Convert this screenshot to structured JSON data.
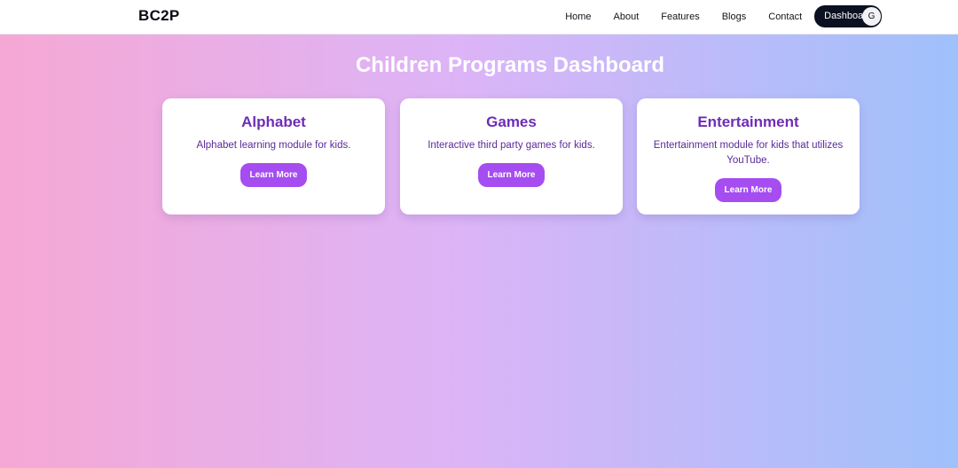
{
  "navbar": {
    "brand": "BC2P",
    "links": [
      "Home",
      "About",
      "Features",
      "Blogs",
      "Contact"
    ],
    "active_link": "Dashboard",
    "avatar_initial": "G"
  },
  "page": {
    "title": "Children Programs Dashboard"
  },
  "cards": [
    {
      "title": "Alphabet",
      "description": "Alphabet learning module for kids.",
      "button_label": "Learn More"
    },
    {
      "title": "Games",
      "description": "Interactive third party games for kids.",
      "button_label": "Learn More"
    },
    {
      "title": "Entertainment",
      "description": "Entertainment module for kids that utilizes YouTube.",
      "button_label": "Learn More"
    }
  ],
  "colors": {
    "accent": "#a54df0",
    "card_title": "#6e2cb6",
    "nav_active_bg": "#0b1120",
    "gradient_left": "#f6a8d4",
    "gradient_mid": "#dcb4f7",
    "gradient_right": "#9fc1fb"
  }
}
